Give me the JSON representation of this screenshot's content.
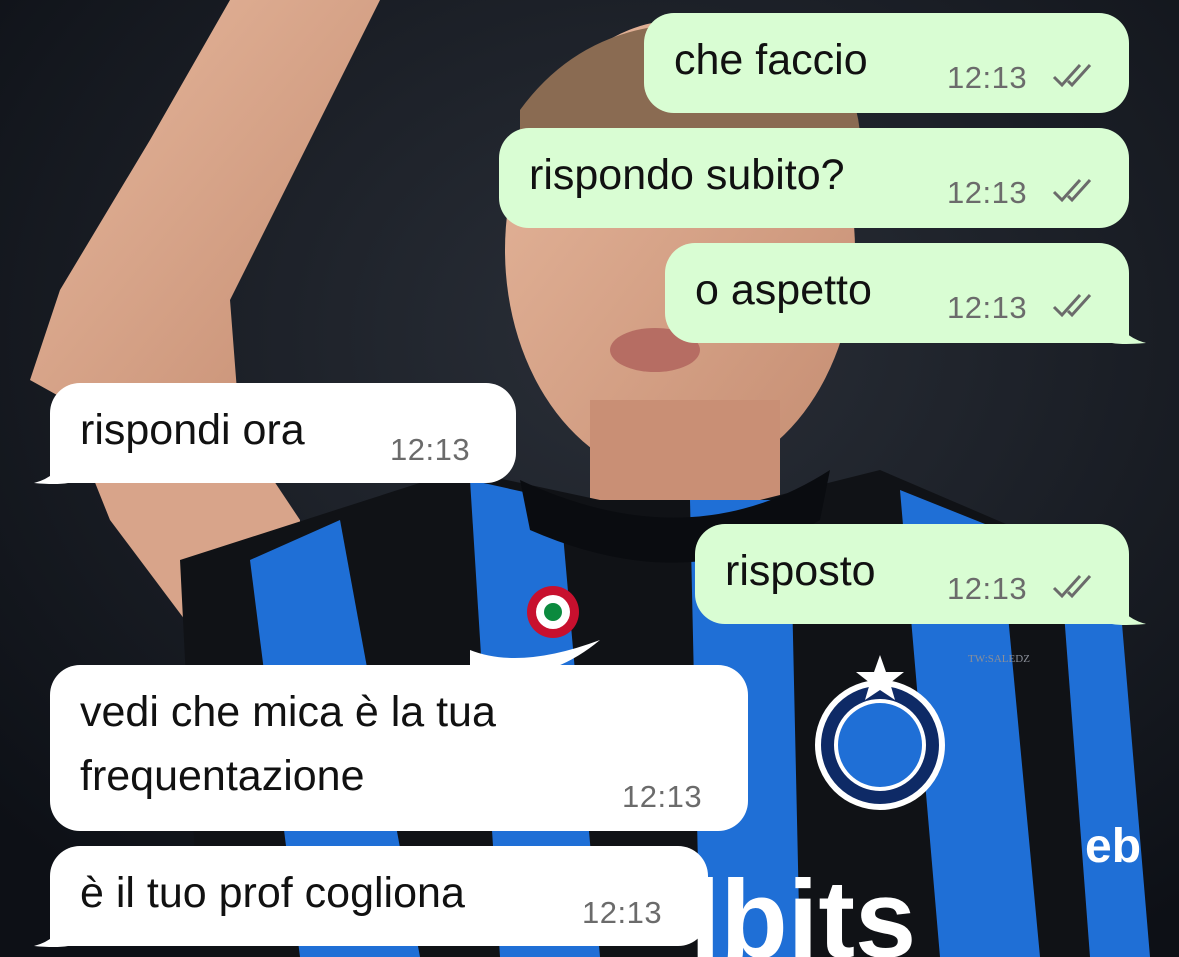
{
  "chat": {
    "messages": [
      {
        "text": "che faccio",
        "time": "12:13",
        "direction": "outgoing",
        "status": "read-ticks-icon"
      },
      {
        "text": "rispondo subito?",
        "time": "12:13",
        "direction": "outgoing",
        "status": "read-ticks-icon"
      },
      {
        "text": "o aspetto",
        "time": "12:13",
        "direction": "outgoing",
        "status": "read-ticks-icon"
      },
      {
        "text": "rispondi ora",
        "time": "12:13",
        "direction": "incoming"
      },
      {
        "text": "risposto",
        "time": "12:13",
        "direction": "outgoing",
        "status": "read-ticks-icon"
      },
      {
        "lines": [
          "vedi che mica è la tua",
          "frequentazione"
        ],
        "time": "12:13",
        "direction": "incoming"
      },
      {
        "text": "è il tuo prof cogliona",
        "time": "12:13",
        "direction": "incoming"
      }
    ]
  },
  "background": {
    "watermark": "TW:SALEDZ",
    "sponsor_partial": "lbits",
    "sleeve_logo": "eb"
  },
  "colors": {
    "outgoing_bubble": "#d9fdd3",
    "incoming_bubble": "#ffffff",
    "time_text": "#6b6b6b",
    "tick_color": "#6b6b6b",
    "kit_blue": "#1f6fd6",
    "kit_black": "#101216"
  }
}
